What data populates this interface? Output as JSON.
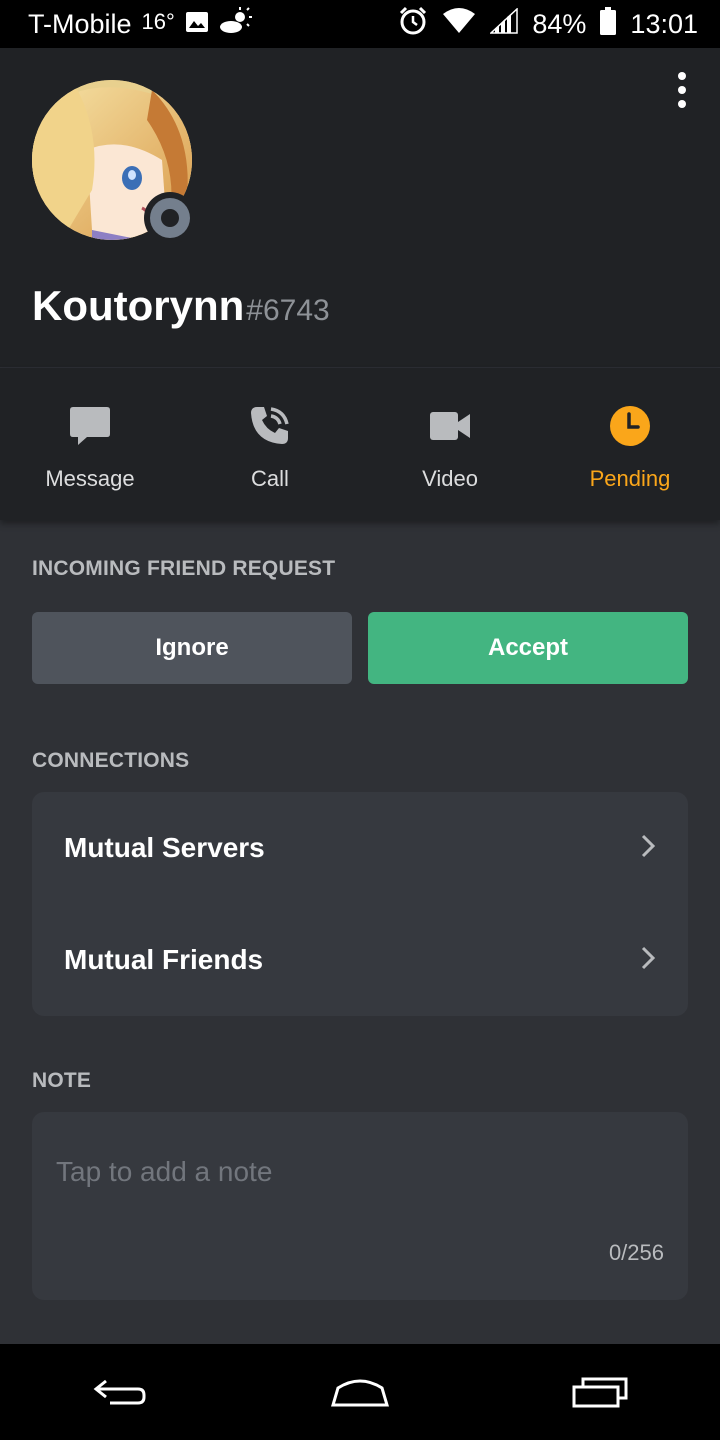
{
  "status_bar": {
    "carrier": "T-Mobile",
    "temperature": "16°",
    "battery": "84%",
    "time": "13:01"
  },
  "profile": {
    "username": "Koutorynn",
    "discriminator": "#6743",
    "status": "offline"
  },
  "actions": [
    {
      "label": "Message",
      "icon": "message-icon"
    },
    {
      "label": "Call",
      "icon": "call-icon"
    },
    {
      "label": "Video",
      "icon": "video-icon"
    },
    {
      "label": "Pending",
      "icon": "clock-icon"
    }
  ],
  "friend_request": {
    "title": "INCOMING FRIEND REQUEST",
    "ignore_label": "Ignore",
    "accept_label": "Accept"
  },
  "connections": {
    "title": "CONNECTIONS",
    "items": [
      {
        "label": "Mutual Servers"
      },
      {
        "label": "Mutual Friends"
      }
    ]
  },
  "note": {
    "title": "NOTE",
    "placeholder": "Tap to add a note",
    "counter": "0/256"
  },
  "colors": {
    "accent_pending": "#faa61a",
    "accept": "#43b581",
    "ignore": "#4f545c"
  }
}
